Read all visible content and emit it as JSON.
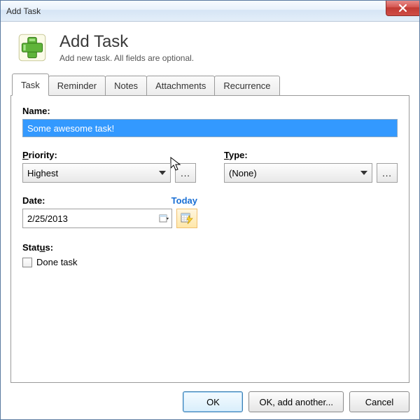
{
  "window": {
    "title": "Add Task"
  },
  "header": {
    "title": "Add Task",
    "subtitle": "Add new task. All fields are optional."
  },
  "tabs": {
    "task": "Task",
    "reminder": "Reminder",
    "notes": "Notes",
    "attachments": "Attachments",
    "recurrence": "Recurrence"
  },
  "form": {
    "name_label": "Name:",
    "name_value": "Some awesome task!",
    "priority_label_pre": "P",
    "priority_label_rest": "riority:",
    "priority_value": "Highest",
    "type_label_pre": "T",
    "type_label_rest": "ype:",
    "type_value": "(None)",
    "ellipsis": "...",
    "date_label": "Date:",
    "today_link": "Today",
    "date_value": "2/25/2013",
    "status_label_pre": "Stat",
    "status_label_u": "u",
    "status_label_post": "s:",
    "done_label": "Done task"
  },
  "buttons": {
    "ok": "OK",
    "ok_add": "OK, add another...",
    "cancel": "Cancel"
  }
}
